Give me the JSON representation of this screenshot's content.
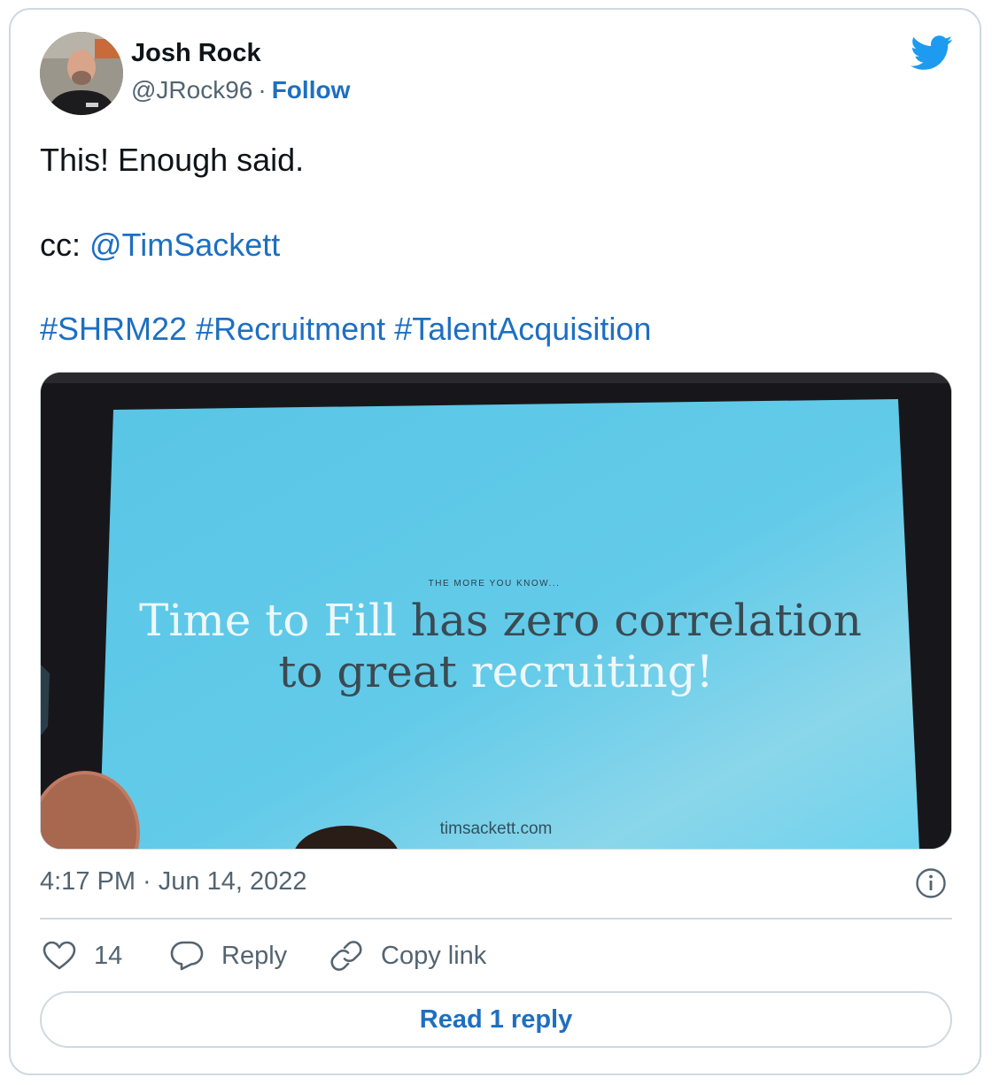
{
  "author": {
    "name": "Josh Rock",
    "handle": "@JRock96",
    "separator": "·",
    "follow_label": "Follow"
  },
  "tweet": {
    "line1": "This! Enough said.",
    "cc_prefix": "cc: ",
    "mention": "@TimSackett",
    "hashtags": [
      "#SHRM22",
      "#Recruitment",
      "#TalentAcquisition"
    ]
  },
  "media": {
    "slide_kicker": "THE MORE YOU KNOW...",
    "slide_line1_highlight": "Time to Fill",
    "slide_line1_rest": " has zero correlation",
    "slide_line2_start": "to great ",
    "slide_line2_highlight": "recruiting!",
    "slide_url": "timsackett.com"
  },
  "timestamp": "4:17 PM · Jun 14, 2022",
  "actions": {
    "like_count": "14",
    "reply_label": "Reply",
    "copy_label": "Copy link"
  },
  "read_replies_label": "Read 1 reply",
  "colors": {
    "link": "#1d6fc2",
    "twitter_blue": "#1d9bf0",
    "secondary_text": "#536471",
    "border": "#cfd9de"
  },
  "icons": [
    "avatar",
    "twitter-bird-icon",
    "info-icon",
    "heart-icon",
    "reply-bubble-icon",
    "link-icon"
  ]
}
